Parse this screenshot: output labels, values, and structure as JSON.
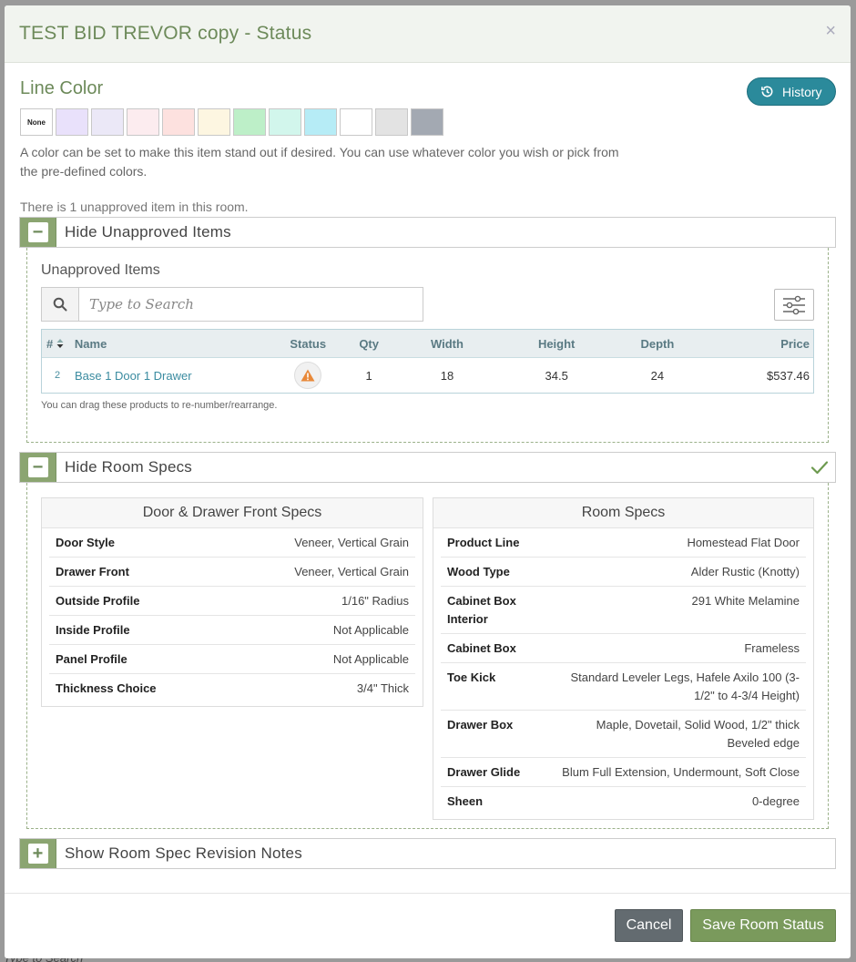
{
  "modal": {
    "title": "TEST BID TREVOR copy - Status",
    "close_glyph": "×"
  },
  "line_color": {
    "title": "Line Color",
    "history_label": "History",
    "none_label": "None",
    "swatches": [
      "#e9e1fb",
      "#ebe8f7",
      "#fcecef",
      "#fde1df",
      "#fdf6e1",
      "#bdefc8",
      "#d2f6ec",
      "#b6ecf6",
      "#ffffff",
      "#e3e3e3",
      "#a3a9b2"
    ],
    "help": "A color can be set to make this item stand out if desired. You can use whatever color you wish or pick from the pre-defined colors."
  },
  "unapproved_note": "There is 1 unapproved item in this room.",
  "sections": {
    "hide_unapproved": "Hide Unapproved Items",
    "hide_room_specs": "Hide Room Specs",
    "show_revision_notes": "Show Room Spec Revision Notes",
    "minus": "−",
    "plus": "+"
  },
  "unapproved": {
    "title": "Unapproved Items",
    "search_placeholder": "Type to Search",
    "columns": {
      "num": "#",
      "name": "Name",
      "status": "Status",
      "qty": "Qty",
      "width": "Width",
      "height": "Height",
      "depth": "Depth",
      "price": "Price"
    },
    "rows": [
      {
        "num": "2",
        "name": "Base 1 Door 1 Drawer",
        "qty": "1",
        "width": "18",
        "height": "34.5",
        "depth": "24",
        "price": "$537.46"
      }
    ],
    "drag_note": "You can drag these products to re-number/rearrange."
  },
  "door_specs": {
    "title": "Door & Drawer Front Specs",
    "rows": [
      {
        "key": "Door Style",
        "value": "Veneer, Vertical Grain"
      },
      {
        "key": "Drawer Front",
        "value": "Veneer, Vertical Grain"
      },
      {
        "key": "Outside Profile",
        "value": "1/16\" Radius"
      },
      {
        "key": "Inside Profile",
        "value": "Not Applicable"
      },
      {
        "key": "Panel Profile",
        "value": "Not Applicable"
      },
      {
        "key": "Thickness Choice",
        "value": "3/4\" Thick"
      }
    ]
  },
  "room_specs": {
    "title": "Room Specs",
    "rows": [
      {
        "key": "Product Line",
        "value": "Homestead Flat Door"
      },
      {
        "key": "Wood Type",
        "value": "Alder Rustic (Knotty)"
      },
      {
        "key": "Cabinet Box Interior",
        "value": "291 White Melamine"
      },
      {
        "key": "Cabinet Box",
        "value": "Frameless"
      },
      {
        "key": "Toe Kick",
        "value": "Standard Leveler Legs, Hafele Axilo 100 (3-1/2\" to 4-3/4 Height)"
      },
      {
        "key": "Drawer Box",
        "value": "Maple, Dovetail, Solid Wood, 1/2\" thick Beveled edge"
      },
      {
        "key": "Drawer Glide",
        "value": "Blum Full Extension, Undermount, Soft Close"
      },
      {
        "key": "Sheen",
        "value": "0-degree"
      }
    ]
  },
  "footer": {
    "cancel": "Cancel",
    "save": "Save Room Status"
  },
  "background": {
    "peek_text": "Type to Search"
  }
}
